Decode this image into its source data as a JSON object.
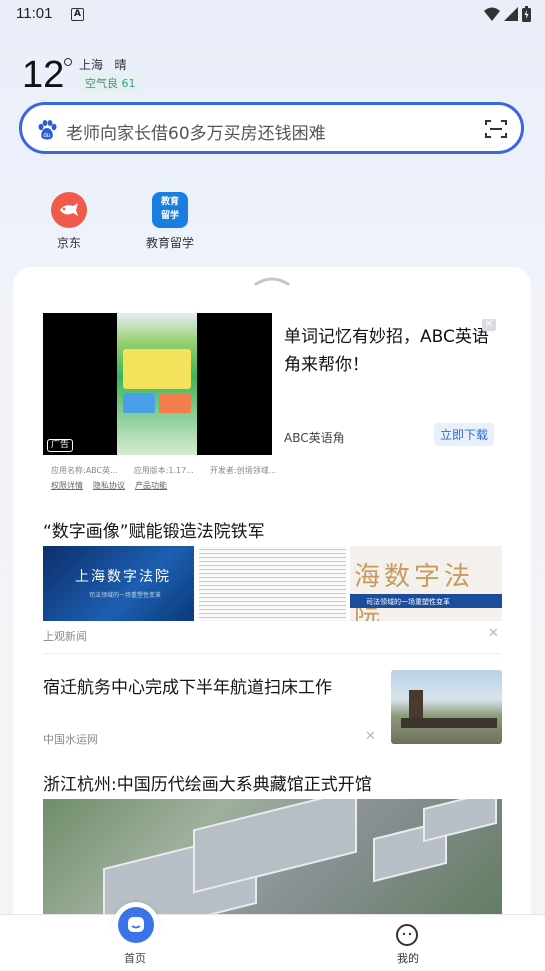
{
  "status_bar": {
    "time": "11:01",
    "notification_icon": "A"
  },
  "weather": {
    "temperature": "12",
    "city": "上海",
    "condition": "晴",
    "air_quality_label": "空气良",
    "air_quality_value": "61"
  },
  "search": {
    "placeholder_query": "老师向家长借60多万买房还钱困难"
  },
  "shortcuts": [
    {
      "label": "京东",
      "icon": "jd-icon",
      "color": "#f05a4a"
    },
    {
      "label": "教育留学",
      "icon": "education-icon",
      "icon_text": "教育\n留学",
      "color": "#1a7de0"
    }
  ],
  "feed": {
    "ad": {
      "title": "单词记忆有妙招，ABC英语角来帮你！",
      "source": "ABC英语角",
      "cta": "立即下载",
      "badge": "广告",
      "meta": [
        "应用名称:ABC英...",
        "应用版本:1.17...",
        "开发者:创境领域..."
      ],
      "links": [
        "权限详情",
        "隐私协议",
        "产品功能"
      ]
    },
    "articles": [
      {
        "title": "“数字画像”赋能锻造法院铁军",
        "source": "上观新闻",
        "image_texts": [
          "上海数字法院",
          "司法领域的一场重塑性变革",
          "海数字法院",
          "司法领域的一场重塑性变革"
        ]
      },
      {
        "title": "宿迁航务中心完成下半年航道扫床工作",
        "source": "中国水运网"
      },
      {
        "title": "浙江杭州:中国历代绘画大系典藏馆正式开馆"
      }
    ]
  },
  "bottom_nav": {
    "home": "首页",
    "mine": "我的"
  },
  "colors": {
    "accent": "#3a66e0",
    "cta": "#2a6bd8"
  }
}
